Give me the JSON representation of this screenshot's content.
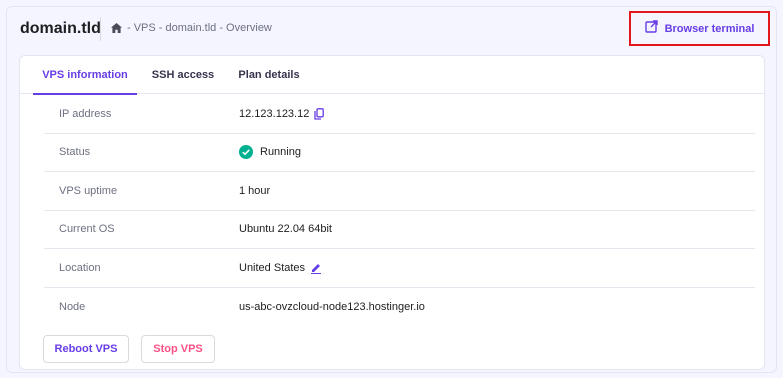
{
  "header": {
    "domain_title": "domain.tld",
    "breadcrumb": "- VPS - domain.tld - Overview",
    "terminal_button": "Browser terminal"
  },
  "tabs": [
    {
      "label": "VPS information",
      "active": true
    },
    {
      "label": "SSH access",
      "active": false
    },
    {
      "label": "Plan details",
      "active": false
    }
  ],
  "info_rows": [
    {
      "label": "IP address",
      "value": "12.123.123.12",
      "icon": "copy-icon"
    },
    {
      "label": "Status",
      "value": "Running",
      "icon": "check-circle-icon"
    },
    {
      "label": "VPS uptime",
      "value": "1 hour"
    },
    {
      "label": "Current OS",
      "value": "Ubuntu 22.04 64bit"
    },
    {
      "label": "Location",
      "value": "United States",
      "icon": "edit-icon"
    },
    {
      "label": "Node",
      "value": "us-abc-ovzcloud-node123.hostinger.io"
    }
  ],
  "actions": {
    "reboot": "Reboot VPS",
    "stop": "Stop VPS"
  },
  "colors": {
    "accent": "#673de6",
    "danger": "#fc5185",
    "success": "#00b090",
    "highlight_border": "#e3161c"
  }
}
